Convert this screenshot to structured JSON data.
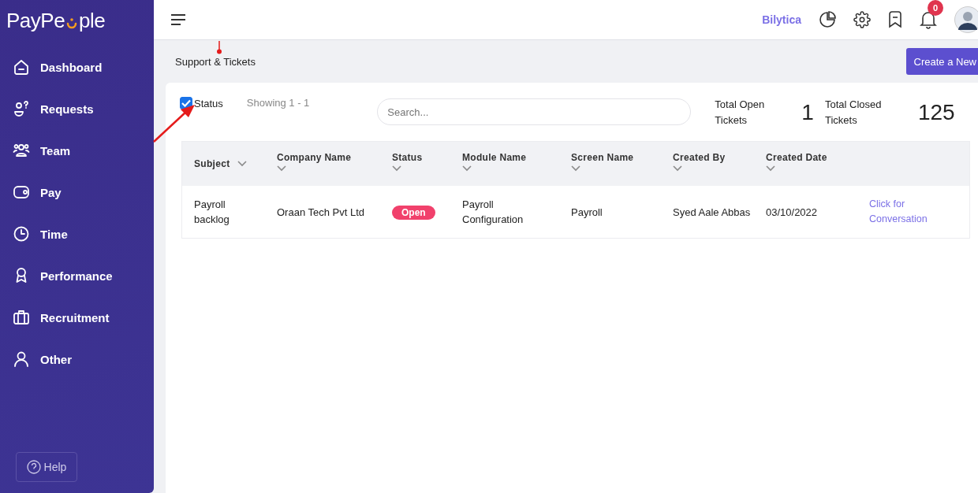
{
  "logo": {
    "lead": "PayPe",
    "tail": "ple"
  },
  "sidebar": {
    "items": [
      {
        "label": "Dashboard"
      },
      {
        "label": "Requests"
      },
      {
        "label": "Team"
      },
      {
        "label": "Pay"
      },
      {
        "label": "Time"
      },
      {
        "label": "Performance"
      },
      {
        "label": "Recruitment"
      },
      {
        "label": "Other"
      }
    ],
    "help": "Help"
  },
  "header": {
    "brand": "Bilytica",
    "notifications": "0"
  },
  "page": {
    "title": "Support & Tickets",
    "create_button": "Create a New"
  },
  "toolbar": {
    "status_filter": {
      "label": "Status",
      "checked": true
    },
    "showing": "Showing 1 - 1",
    "search": {
      "placeholder": "Search..."
    }
  },
  "stats": [
    {
      "label": "Total Open Tickets",
      "value": "1"
    },
    {
      "label": "Total Closed Tickets",
      "value": "125"
    }
  ],
  "table": {
    "columns": [
      "Subject",
      "Company Name",
      "Status",
      "Module Name",
      "Screen Name",
      "Created By",
      "Created Date"
    ],
    "rows": [
      {
        "subject": "Payroll backlog",
        "company": "Oraan Tech Pvt Ltd",
        "status": "Open",
        "module": "Payroll Configuration",
        "screen": "Payroll",
        "created_by": "Syed Aale Abbas",
        "created_date": "03/10/2022",
        "link": "Click for Conversation"
      }
    ]
  }
}
